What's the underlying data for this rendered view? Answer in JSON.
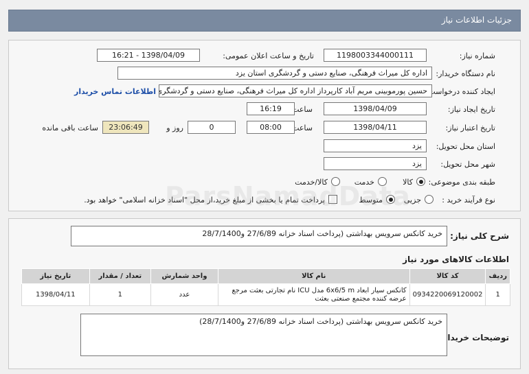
{
  "header": {
    "title": "جزئیات اطلاعات نیاز"
  },
  "labels": {
    "need_number": "شماره نیاز:",
    "announce_datetime": "تاریخ و ساعت اعلان عمومی:",
    "buyer_org": "نام دستگاه خریدار:",
    "requester": "ایجاد کننده درخواست:",
    "contact_link": "اطلاعات تماس خریدار",
    "created_date": "تاریخ ایجاد نیاز:",
    "time": "ساعت",
    "valid_date": "تاریخ اعتبار نیاز:",
    "day_and": "روز و",
    "remaining": "ساعت باقی مانده",
    "delivery_province": "استان محل تحویل:",
    "delivery_city": "شهر محل تحویل:",
    "category": "طبقه بندی موضوعی:",
    "process_type": "نوع فرآیند خرید :",
    "general_desc": "شرح کلی نیاز:",
    "items_title": "اطلاعات کالاهای مورد نیاز",
    "buyer_notes": "توضیحات خریدار:"
  },
  "values": {
    "need_number": "1198003344000111",
    "announce_datetime": "1398/04/09 - 16:21",
    "buyer_org": "اداره کل میراث فرهنگی، صنایع دستی و گردشگری استان یزد",
    "requester": "حسین پورموبینی مریم آباد کارپرداز اداره کل میراث فرهنگی، صنایع دستی و گردشگری",
    "created_date": "1398/04/09",
    "created_time": "16:19",
    "valid_date": "1398/04/11",
    "valid_time": "08:00",
    "days_left": "0",
    "time_left": "23:06:49",
    "delivery_province": "یزد",
    "delivery_city": "یزد"
  },
  "category_options": [
    {
      "label": "کالا",
      "checked": true
    },
    {
      "label": "خدمت",
      "checked": false
    },
    {
      "label": "کالا/خدمت",
      "checked": false
    }
  ],
  "process_options": [
    {
      "label": "جزیی",
      "checked": false
    },
    {
      "label": "متوسط",
      "checked": true
    }
  ],
  "treasury_note": "پرداخت تمام یا بخشی از مبلغ خرید،از محل \"اسناد خزانه اسلامی\" خواهد بود.",
  "general_desc_text": "خرید کانکس سرویس بهداشتی (پرداخت اسناد خزانه 27/6/89 و28/7/1400",
  "items_table": {
    "headers": [
      "ردیف",
      "کد کالا",
      "نام کالا",
      "واحد شمارش",
      "تعداد / مقدار",
      "تاریخ نیاز"
    ],
    "rows": [
      [
        "1",
        "0934220069120002",
        "کانکس سیار ابعاد 6x6/5 m مدل ICU نام تجارتی بعثت مرجع عرضه کننده مجتمع صنعتی بعثت",
        "عدد",
        "1",
        "1398/04/11"
      ]
    ]
  },
  "buyer_notes_text": "خرید کانکس سرویس بهداشتی (پرداخت اسناد خزانه 27/6/89 و28/7/1400)",
  "watermark": "ParsNamadData"
}
